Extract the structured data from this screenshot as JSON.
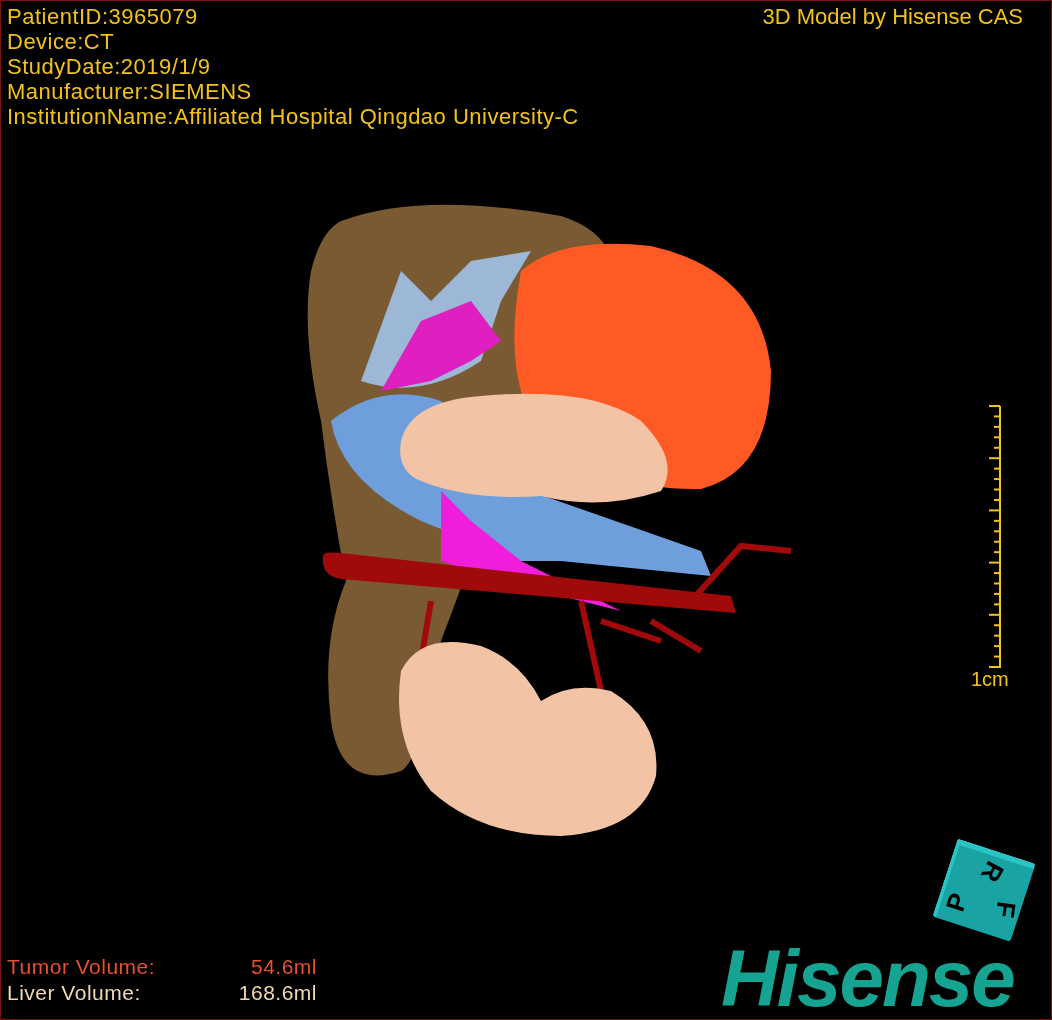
{
  "header_fields": [
    {
      "label": "PatientID:",
      "value": "3965079"
    },
    {
      "label": "Device:",
      "value": "CT"
    },
    {
      "label": "StudyDate:",
      "value": "2019/1/9"
    },
    {
      "label": "Manufacturer:",
      "value": "SIEMENS"
    },
    {
      "label": "InstitutionName:",
      "value": "Affiliated Hospital Qingdao University-C"
    }
  ],
  "model_credit": "3D Model by Hisense CAS",
  "scale_bar": {
    "label": "1cm"
  },
  "volumes": [
    {
      "label": "Tumor Volume:",
      "value": "54.6ml",
      "color": "#e8502a"
    },
    {
      "label": "Liver Volume:",
      "value": "168.6ml",
      "color": "#f2d9b0"
    }
  ],
  "orientation_cube": {
    "faces": [
      "P",
      "R",
      "F"
    ]
  },
  "logo": "Hisense"
}
